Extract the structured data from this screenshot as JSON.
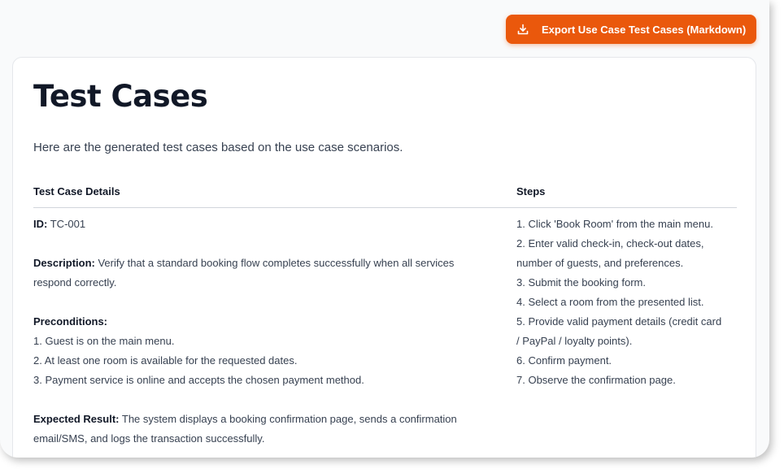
{
  "toolbar": {
    "export_label": "Export Use Case Test Cases (Markdown)",
    "export_icon": "download-icon"
  },
  "page": {
    "title": "Test Cases",
    "intro": "Here are the generated test cases based on the use case scenarios."
  },
  "table": {
    "headers": [
      "Test Case Details",
      "Steps"
    ],
    "rows": [
      {
        "id_label": "ID:",
        "id_value": "TC-001",
        "description_label": "Description:",
        "description_line1": "Verify that a standard booking flow completes successfully when all services",
        "description_line2": "respond correctly.",
        "preconditions_label": "Preconditions:",
        "preconditions": [
          "1. Guest is on the main menu.",
          "2. At least one room is available for the requested dates.",
          "3. Payment service is online and accepts the chosen payment method."
        ],
        "expected_label": "Expected Result:",
        "expected_line1": "The system displays a booking confirmation page, sends a confirmation",
        "expected_line2": "email/SMS, and logs the transaction successfully.",
        "steps": [
          "1. Click 'Book Room' from the main menu.",
          "2. Enter valid check-in, check-out dates,",
          "number of guests, and preferences.",
          "3. Submit the booking form.",
          "4. Select a room from the presented list.",
          "5. Provide valid payment details (credit card",
          "/ PayPal / loyalty points).",
          "6. Confirm payment.",
          "7. Observe the confirmation page."
        ]
      }
    ]
  },
  "colors": {
    "accent": "#ea580c",
    "title": "#111827",
    "text": "#374151"
  }
}
